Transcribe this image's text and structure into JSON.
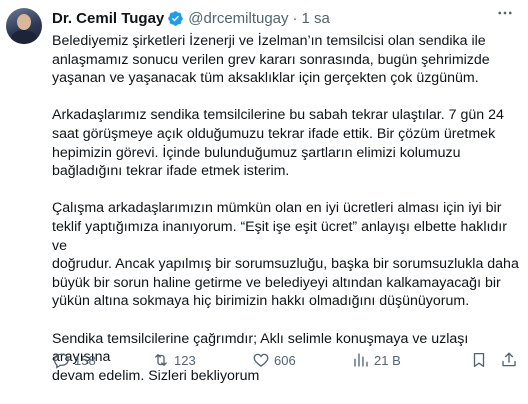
{
  "author": {
    "name": "Dr. Cemil Tugay",
    "handle": "@drcemiltugay",
    "separator": "·",
    "time": "1 sa"
  },
  "tweet": {
    "paragraphs": [
      "Belediyemiz şirketleri İzenerji ve İzelman’ın temsilcisi olan sendika ile\nanlaşmamız sonucu verilen grev kararı sonrasında, bugün şehrimizde\nyaşanan ve yaşanacak tüm aksaklıklar için gerçekten çok üzgünüm.",
      "Arkadaşlarımız sendika temsilcilerine bu sabah tekrar ulaştılar. 7 gün 24\nsaat görüşmeye açık olduğumuzu tekrar ifade ettik. Bir çözüm üretmek\nhepimizin görevi. İçinde bulunduğumuz şartların elimizi kolumuzu\nbağladığını tekrar ifade etmek isterim.",
      "Çalışma arkadaşlarımızın mümkün olan en iyi ücretleri alması için iyi bir\nteklif yaptığımıza inanıyorum. “Eşit işe eşit ücret” anlayışı elbette haklıdır ve\ndoğrudur. Ancak yapılmış bir sorumsuzluğu, başka bir sorumsuzlukla daha\nbüyük bir sorun haline getirme ve belediyeyi altından kalkamayacağı bir\nyükün altına sokmaya hiç birimizin hakkı olmadığını düşünüyorum.",
      "Sendika temsilcilerine çağrımdır; Aklı selimle konuşmaya ve uzlaşı arayışına\ndevam edelim. Sizleri bekliyorum"
    ]
  },
  "actions": {
    "replies": "158",
    "retweets": "123",
    "likes": "606",
    "views": "21 B"
  },
  "colors": {
    "text": "#0f1419",
    "muted": "#536471",
    "verified": "#1d9bf0"
  }
}
